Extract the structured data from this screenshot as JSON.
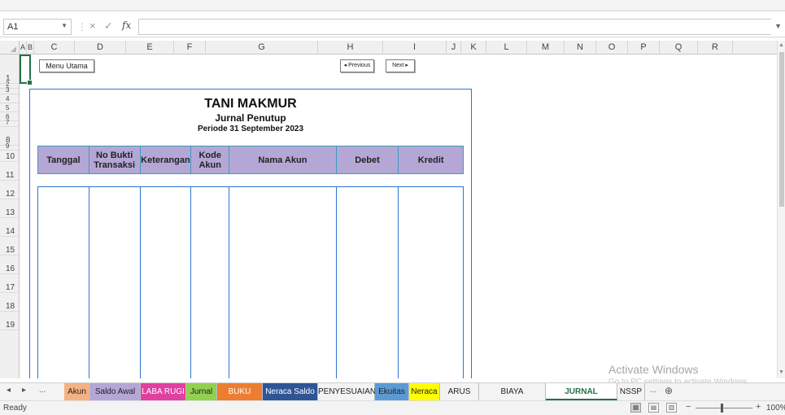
{
  "formula_bar": {
    "cell_ref": "A1",
    "fx_label": "fx",
    "cancel_glyph": "×",
    "enter_glyph": "✓"
  },
  "columns": [
    "A",
    "B",
    "C",
    "D",
    "E",
    "F",
    "G",
    "H",
    "I",
    "J",
    "K",
    "L",
    "M",
    "N",
    "O",
    "P",
    "Q",
    "R"
  ],
  "rows": [
    "1",
    "2",
    "3",
    "4",
    "5",
    "6",
    "7",
    "8",
    "9",
    "10",
    "11",
    "12",
    "13",
    "14",
    "15",
    "16",
    "17",
    "18",
    "19"
  ],
  "buttons": {
    "menu_utama": "Menu Utama",
    "previous": "◂ Previous",
    "next": "Next ▸"
  },
  "report": {
    "company": "TANI MAKMUR",
    "title": "Jurnal Penutup",
    "period": "Periode 31 September 2023",
    "headers": [
      "Tanggal",
      "No Bukti Transaksi",
      "Keterangan",
      "Kode Akun",
      "Nama Akun",
      "Debet",
      "Kredit"
    ]
  },
  "watermark": {
    "line1": "Activate Windows",
    "line2": "Go to PC settings to activate Windows."
  },
  "tabs": [
    {
      "label": "Akun",
      "color": "#f4b183"
    },
    {
      "label": "Saldo Awal",
      "color": "#b4a7d6"
    },
    {
      "label": "LABA RUGI",
      "color": "#e040a0"
    },
    {
      "label": "Jurnal",
      "color": "#92d050"
    },
    {
      "label": "BUKU BESAR",
      "color": "#ed7d31"
    },
    {
      "label": "Neraca Saldo",
      "color": "#2f5597"
    },
    {
      "label": "PENYESUAIAN",
      "color": ""
    },
    {
      "label": "Ekuitas",
      "color": "#5b9bd5"
    },
    {
      "label": "Neraca",
      "color": "#ffff00"
    },
    {
      "label": "ARUS KAS",
      "color": ""
    },
    {
      "label": "BIAYA PRODUKSI",
      "color": ""
    },
    {
      "label": "JURNAL PENUTUP",
      "color": ""
    },
    {
      "label": "NSSP",
      "color": ""
    }
  ],
  "tab_nav": {
    "ellipsis": "...",
    "more": "...",
    "add": "⊕"
  },
  "status": {
    "ready": "Ready",
    "zoom": "100%"
  }
}
